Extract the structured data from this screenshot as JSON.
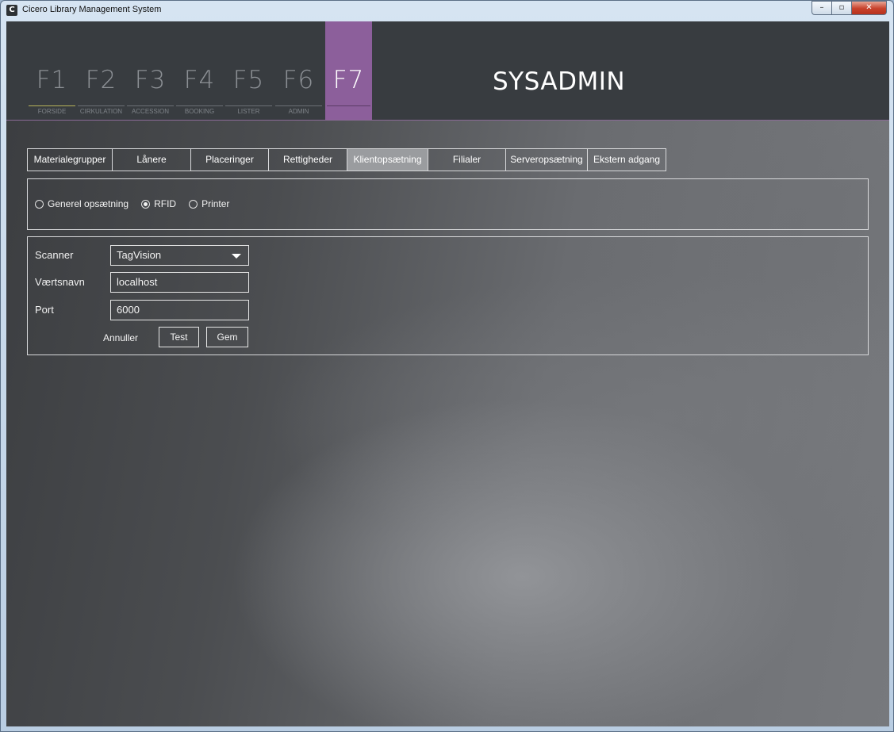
{
  "window": {
    "title": "Cicero Library Management System",
    "icon_letter": "C",
    "controls": {
      "minimize": "–",
      "maximize": "▫",
      "close": "✕"
    }
  },
  "header": {
    "fkeys": [
      {
        "key": "F1",
        "label": "FORSIDE"
      },
      {
        "key": "F2",
        "label": "CIRKULATION"
      },
      {
        "key": "F3",
        "label": "ACCESSION"
      },
      {
        "key": "F4",
        "label": "BOOKING"
      },
      {
        "key": "F5",
        "label": "LISTER"
      },
      {
        "key": "F6",
        "label": "ADMIN"
      },
      {
        "key": "F7",
        "label": ""
      }
    ],
    "active_fkey": "F7",
    "section_title": "SYSADMIN"
  },
  "tabs": [
    "Materialegrupper",
    "Lånere",
    "Placeringer",
    "Rettigheder",
    "Klientopsætning",
    "Filialer",
    "Serveropsætning",
    "Ekstern adgang"
  ],
  "active_tab": "Klientopsætning",
  "radio_options": [
    {
      "label": "Generel opsætning",
      "checked": false
    },
    {
      "label": "RFID",
      "checked": true
    },
    {
      "label": "Printer",
      "checked": false
    }
  ],
  "form": {
    "scanner": {
      "label": "Scanner",
      "value": "TagVision"
    },
    "hostname": {
      "label": "Værtsnavn",
      "value": "localhost"
    },
    "port": {
      "label": "Port",
      "value": "6000"
    },
    "cancel_label": "Annuller",
    "test_label": "Test",
    "save_label": "Gem"
  },
  "colors": {
    "header_bg": "#383c40",
    "active_fkey": "#8c5f9b",
    "f1_underline": "#b7b45a",
    "active_tab_bg": "#9a9c9f"
  }
}
